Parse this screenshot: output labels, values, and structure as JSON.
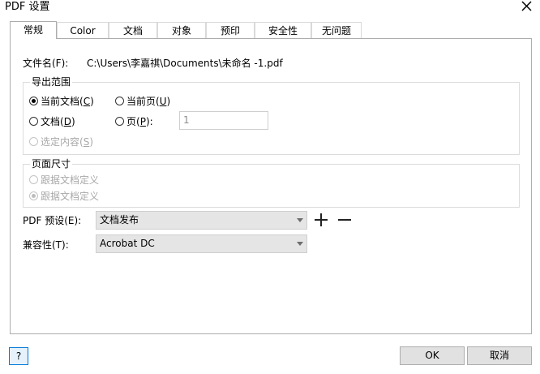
{
  "window": {
    "title": "PDF 设置"
  },
  "tabs": [
    "常规",
    "Color",
    "文档",
    "对象",
    "预印",
    "安全性",
    "无问题"
  ],
  "general": {
    "filename_label": "文件名(F):",
    "filename_value": "C:\\Users\\李嘉祺\\Documents\\未命名 -1.pdf",
    "export_range": {
      "legend": "导出范围",
      "current_document": {
        "text": "当前文档(",
        "key": "C",
        "end": ")"
      },
      "current_page": {
        "text": "当前页(",
        "key": "U",
        "end": ")"
      },
      "documents": {
        "text": "文档(",
        "key": "D",
        "end": ")"
      },
      "pages": {
        "text": "页(",
        "key": "P",
        "end": "):"
      },
      "pages_value": "1",
      "selection": {
        "text": "选定内容(",
        "key": "S",
        "end": ")"
      }
    },
    "page_size": {
      "legend": "页面尺寸",
      "option1": "跟据文档定义",
      "option2": "跟据文档定义"
    },
    "pdf_preset_label": "PDF 预设(E):",
    "pdf_preset_value": "文档发布",
    "compatibility_label": "兼容性(T):",
    "compatibility_value": "Acrobat DC"
  },
  "footer": {
    "help": "?",
    "ok": "OK",
    "cancel": "取消"
  },
  "icons": {
    "close": "close-icon",
    "add": "plus-icon",
    "remove": "minus-icon"
  }
}
